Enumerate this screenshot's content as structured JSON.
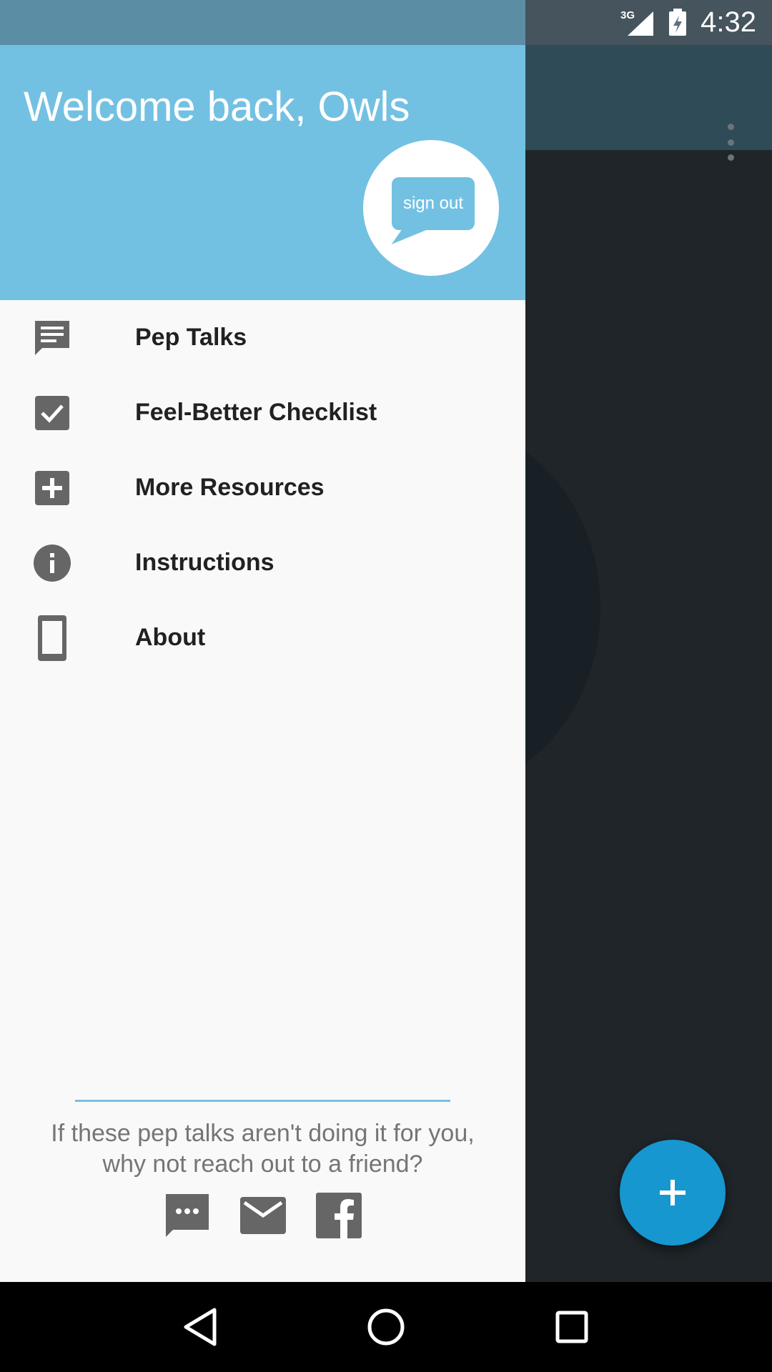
{
  "status_bar": {
    "network": "3G",
    "time": "4:32"
  },
  "drawer": {
    "welcome_text": "Welcome back, Owls",
    "sign_out_label": "sign out",
    "menu_items": [
      {
        "label": "Pep Talks",
        "icon": "chat-icon"
      },
      {
        "label": "Feel-Better Checklist",
        "icon": "checkbox-icon"
      },
      {
        "label": "More Resources",
        "icon": "add-box-icon"
      },
      {
        "label": "Instructions",
        "icon": "info-icon"
      },
      {
        "label": "About",
        "icon": "phone-icon"
      }
    ],
    "footer_text_line1": "If these pep talks aren't doing it for you,",
    "footer_text_line2": "why not reach out to a friend?",
    "share_icons": [
      "sms-icon",
      "email-icon",
      "facebook-icon"
    ]
  },
  "colors": {
    "header_blue": "#73c1e2",
    "drawer_statusbar": "#5b8ea5",
    "fab_blue": "#1797cf",
    "icon_gray": "#666666"
  }
}
